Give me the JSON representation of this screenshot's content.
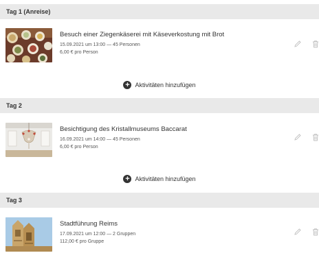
{
  "days": [
    {
      "label": "Tag 1 (Anreise)",
      "activity": {
        "title": "Besuch einer Ziegenkäserei mit Käseverkostung mit Brot",
        "meta": "15.09.2021 um 13:00 — 45 Personen",
        "price": "6,00 € pro Person",
        "image": "cheese-plates-photo"
      },
      "add_label": "Aktivitäten hinzufügen"
    },
    {
      "label": "Tag 2",
      "activity": {
        "title": "Besichtigung des Kristallmuseums Baccarat",
        "meta": "16.09.2021 um 14:00 — 45 Personen",
        "price": "6,00 € pro Person",
        "image": "chandelier-photo"
      },
      "add_label": "Aktivitäten hinzufügen"
    },
    {
      "label": "Tag 3",
      "activity": {
        "title": "Stadtführung Reims",
        "meta": "17.09.2021 um 12:00 — 2 Gruppen",
        "price": "112,00 € pro Gruppe",
        "image": "cathedral-photo"
      }
    }
  ],
  "icons": {
    "edit": "pencil-icon",
    "delete": "trash-icon",
    "add": "plus-circle-icon"
  }
}
